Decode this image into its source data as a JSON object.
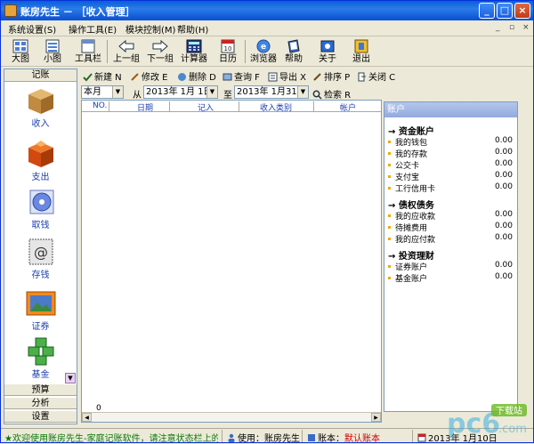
{
  "window": {
    "title": "账房先生 － ［收入管理］",
    "minimize": "_",
    "maximize": "□",
    "close": "×"
  },
  "menu": {
    "items": [
      "系统设置(S)",
      "操作工具(E)",
      "模块控制(M)",
      "帮助(H)"
    ],
    "mdi_min": "_",
    "mdi_restore": "▫",
    "mdi_close": "×"
  },
  "toolbar": {
    "items": [
      {
        "label": "大图",
        "icon": "large-icons-icon"
      },
      {
        "label": "小图",
        "icon": "small-icons-icon"
      },
      {
        "label": "工具栏",
        "icon": "toolbar-icon"
      },
      {
        "label": "上一组",
        "icon": "prev-group-icon"
      },
      {
        "label": "下一组",
        "icon": "next-group-icon"
      },
      {
        "label": "计算器",
        "icon": "calculator-icon"
      },
      {
        "label": "日历",
        "icon": "calendar-icon"
      },
      {
        "label": "浏览器",
        "icon": "browser-icon"
      },
      {
        "label": "帮助",
        "icon": "help-book-icon"
      },
      {
        "label": "关于",
        "icon": "about-icon"
      },
      {
        "label": "退出",
        "icon": "exit-icon"
      }
    ]
  },
  "sidebar": {
    "header": "记账",
    "items": [
      {
        "label": "收入",
        "icon": "income-box-icon"
      },
      {
        "label": "支出",
        "icon": "expense-box-icon"
      },
      {
        "label": "取钱",
        "icon": "withdraw-disk-icon"
      },
      {
        "label": "存钱",
        "icon": "deposit-stamp-icon"
      },
      {
        "label": "证券",
        "icon": "securities-photo-icon"
      },
      {
        "label": "基金",
        "icon": "fund-cubes-icon"
      }
    ],
    "sections": [
      "预算",
      "分析",
      "设置"
    ]
  },
  "actions": {
    "items": [
      "新建 N",
      "修改 E",
      "删除 D",
      "查询 F",
      "导出 X",
      "排序 P",
      "关闭 C"
    ]
  },
  "filter": {
    "period": "本月",
    "from_label": "从",
    "from_date": "2013年 1月 1日",
    "to_label": "至",
    "to_date": "2013年 1月31日",
    "search_label": "检索 R"
  },
  "grid": {
    "columns": [
      "NO.",
      "日期",
      "记入",
      "收入类别",
      "帐户"
    ],
    "total": "0"
  },
  "accounts": {
    "title": "账户",
    "groups": [
      {
        "name": "资金账户",
        "items": [
          {
            "name": "我的钱包",
            "value": "0.00"
          },
          {
            "name": "我的存款",
            "value": "0.00"
          },
          {
            "name": "公交卡",
            "value": "0.00"
          },
          {
            "name": "支付宝",
            "value": "0.00"
          },
          {
            "name": "工行信用卡",
            "value": "0.00"
          }
        ]
      },
      {
        "name": "债权债务",
        "items": [
          {
            "name": "我的应收款",
            "value": "0.00"
          },
          {
            "name": "待摊费用",
            "value": "0.00"
          },
          {
            "name": "我的应付款",
            "value": "0.00"
          }
        ]
      },
      {
        "name": "投资理财",
        "items": [
          {
            "name": "证券账户",
            "value": "0.00"
          },
          {
            "name": "基金账户",
            "value": "0.00"
          }
        ]
      }
    ]
  },
  "status": {
    "welcome": "★欢迎使用账房先生-家庭记账软件，请注意状态栏上的当",
    "user": "使用：账房先生",
    "book_label": "账本：",
    "book": "默认账本",
    "date": "2013年 1月10日"
  },
  "watermark": {
    "text": "pc6",
    "badge": "下载站",
    "domain": ".com"
  },
  "colors": {
    "title_bar": "#0a5fd8",
    "accent_blue": "#1a3fb0",
    "book_red": "#d40000",
    "status_green": "#0a7a0a"
  }
}
